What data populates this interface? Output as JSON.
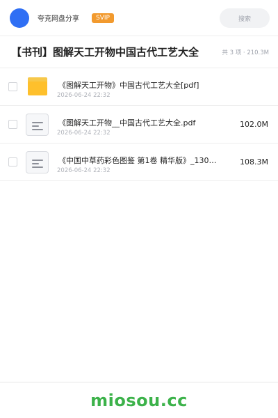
{
  "header": {
    "app_name": "夸克网盘分享",
    "badge": "SVIP",
    "search_placeholder": "搜索"
  },
  "share": {
    "title": "【书刊】图解天工开物中国古代工艺大全",
    "summary": "共 3 项 · 210.3M"
  },
  "files": [
    {
      "type": "folder",
      "icon": "folder-icon",
      "name": "《图解天工开物》中国古代工艺大全[pdf]",
      "date": "2026-06-24 22:32",
      "size": ""
    },
    {
      "type": "file",
      "icon": "document-icon",
      "name": "《图解天工开物__中国古代工艺大全.pdf",
      "date": "2026-06-24 22:32",
      "size": "102.0M"
    },
    {
      "type": "file",
      "icon": "document-icon",
      "name": "《中国中草药彩色图鉴 第1卷 精华版》_130…",
      "date": "2026-06-24 22:32",
      "size": "108.3M"
    }
  ],
  "footer": {
    "watermark": "miosou.cc"
  },
  "colors": {
    "accent_blue": "#2f6ff4",
    "badge_orange": "#f29a2e",
    "folder_yellow": "#fec02c",
    "watermark_green": "#3cb24a"
  }
}
